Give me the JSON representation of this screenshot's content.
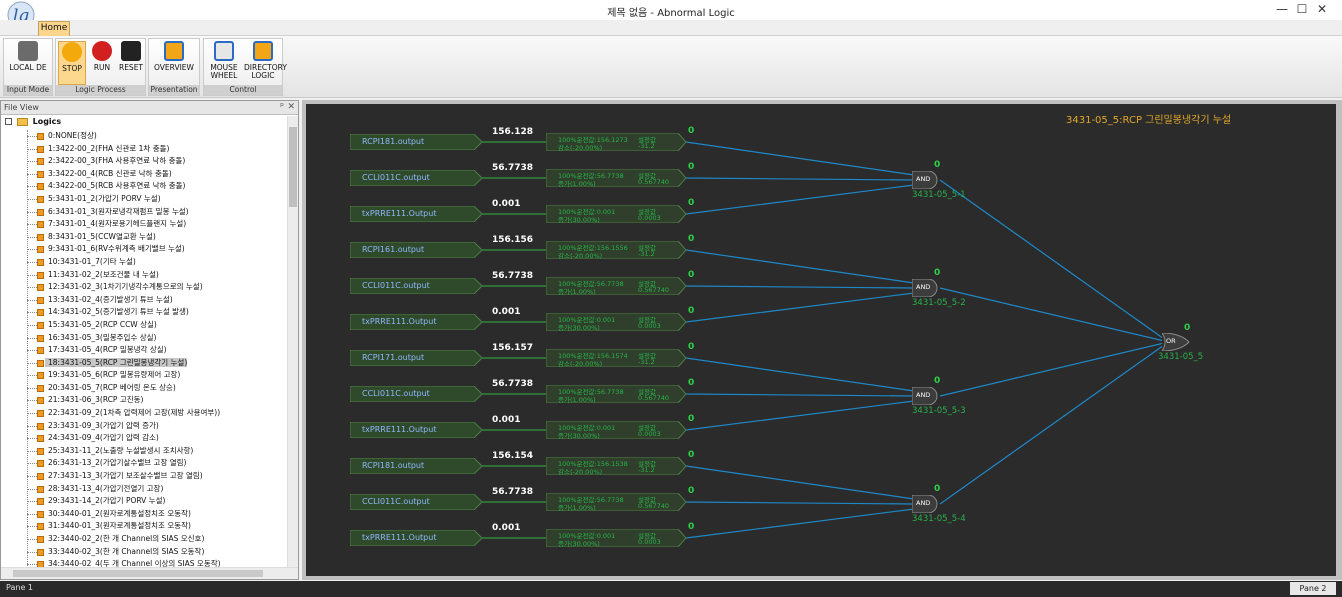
{
  "window": {
    "title": "제목 없음 - Abnormal Logic",
    "minimize": "—",
    "maximize": "☐",
    "close": "✕"
  },
  "ribbon": {
    "tab_home": "Home",
    "groups": {
      "input_mode": "Input Mode",
      "logic_process": "Logic Process",
      "presentation": "Presentation",
      "control": "Control"
    },
    "buttons": {
      "local_de": "LOCAL DE",
      "stop": "STOP",
      "run": "RUN",
      "reset": "RESET",
      "overview": "OVERVIEW",
      "mouse_wheel": "MOUSE WHEEL",
      "directory_logic": "DIRECTORY LOGIC"
    }
  },
  "file_view": {
    "title": "File View",
    "pin": "ᵖ",
    "close": "✕",
    "root": "Logics",
    "items": [
      "0:NONE(정상)",
      "1:3422-00_2(FHA 신관로 1차 충돌)",
      "2:3422-00_3(FHA 사용후연료 낙하 충돌)",
      "3:3422-00_4(RCB 신관로 낙하 충돌)",
      "4:3422-00_5(RCB 사용후연료 낙하 충돌)",
      "5:3431-01_2(가압기 PORV 누설)",
      "6:3431-01_3(원자로냉각재펌프 밀봉 누설)",
      "7:3431-01_4(원자로용기헤드플랜지 누설)",
      "8:3431-01_5(CCW열교환 누설)",
      "9:3431-01_6(RV수위계측 배기밸브 누설)",
      "10:3431-01_7(기타 누설)",
      "11:3431-02_2(보조건물 내 누설)",
      "12:3431-02_3(1차기기냉각수계통으로의 누설)",
      "13:3431-02_4(증기발생기 튜브 누설)",
      "14:3431-02_5(증기발생기 튜브 누설 발생)",
      "15:3431-05_2(RCP CCW 상실)",
      "16:3431-05_3(밀봉주입수 상실)",
      "17:3431-05_4(RCP 밀봉냉각 상실)",
      "18:3431-05_5(RCP 그린밀봉냉각기 누설)",
      "19:3431-05_6(RCP 밀봉유량제어 고장)",
      "20:3431-05_7(RCP 베어링 온도 상승)",
      "21:3431-06_3(RCP 고진동)",
      "22:3431-09_2(1차측 압력제어 고장(제방 사용여부))",
      "23:3431-09_3(가압기 압력 증가)",
      "24:3431-09_4(가압기 압력 감소)",
      "25:3431-11_2(노출량 누설발생시 조치사항)",
      "26:3431-13_2(가압기살수밸브 고장 열림)",
      "27:3431-13_3(가압기 보조살수밸브 고장 열림)",
      "28:3431-13_4(가압기전열기 고장)",
      "29:3431-14_2(가압기 PORV 누설)",
      "30:3440-01_2(원자로계통설정치조 오동작)",
      "31:3440-01_3(원자로계통설정치조 오동작)",
      "32:3440-02_2(한 개 Channel의 SIAS 오신호)",
      "33:3440-02_3(한 개 Channel의 SIAS 오동작)",
      "34:3440-02_4(두 개 Channel 이상의 SIAS 오동작)"
    ]
  },
  "diagram": {
    "title": "3431-05_5:RCP 그린밀봉냉각기 누설",
    "groups": [
      {
        "inputs": [
          "RCPI181.output",
          "CCLI011C.output",
          "txPRRE111.Output"
        ],
        "values": [
          "156.128",
          "56.7738",
          "0.001"
        ],
        "tests": [
          {
            "l1": "100%운전값:156.1273",
            "l2": "감소(-20.00%)",
            "r1": "설정값",
            "r2": "-31.2"
          },
          {
            "l1": "100%운전값:56.7738",
            "l2": "증가(1.00%)",
            "r1": "설정값",
            "r2": "0.567740"
          },
          {
            "l1": "100%운전값:0.001",
            "l2": "증가(30.00%)",
            "r1": "설정값",
            "r2": "0.0003"
          }
        ],
        "bits": [
          "0",
          "0",
          "0"
        ],
        "gate": "AND",
        "gate_out": "0",
        "gate_name": "3431-05_5-1"
      },
      {
        "inputs": [
          "RCPI161.output",
          "CCLI011C.output",
          "txPRRE111.Output"
        ],
        "values": [
          "156.156",
          "56.7738",
          "0.001"
        ],
        "tests": [
          {
            "l1": "100%운전값:156.1556",
            "l2": "감소(-20.00%)",
            "r1": "설정값",
            "r2": "-31.2"
          },
          {
            "l1": "100%운전값:56.7738",
            "l2": "증가(1.00%)",
            "r1": "설정값",
            "r2": "0.567740"
          },
          {
            "l1": "100%운전값:0.001",
            "l2": "증가(30.00%)",
            "r1": "설정값",
            "r2": "0.0003"
          }
        ],
        "bits": [
          "0",
          "0",
          "0"
        ],
        "gate": "AND",
        "gate_out": "0",
        "gate_name": "3431-05_5-2"
      },
      {
        "inputs": [
          "RCPI171.output",
          "CCLI011C.output",
          "txPRRE111.Output"
        ],
        "values": [
          "156.157",
          "56.7738",
          "0.001"
        ],
        "tests": [
          {
            "l1": "100%운전값:156.1574",
            "l2": "감소(-20.00%)",
            "r1": "설정값",
            "r2": "-31.2"
          },
          {
            "l1": "100%운전값:56.7738",
            "l2": "증가(1.00%)",
            "r1": "설정값",
            "r2": "0.567740"
          },
          {
            "l1": "100%운전값:0.001",
            "l2": "증가(30.00%)",
            "r1": "설정값",
            "r2": "0.0003"
          }
        ],
        "bits": [
          "0",
          "0",
          "0"
        ],
        "gate": "AND",
        "gate_out": "0",
        "gate_name": "3431-05_5-3"
      },
      {
        "inputs": [
          "RCPI181.output",
          "CCLI011C.output",
          "txPRRE111.Output"
        ],
        "values": [
          "156.154",
          "56.7738",
          "0.001"
        ],
        "tests": [
          {
            "l1": "100%운전값:156.1538",
            "l2": "감소(-20.00%)",
            "r1": "설정값",
            "r2": "-31.2"
          },
          {
            "l1": "100%운전값:56.7738",
            "l2": "증가(1.00%)",
            "r1": "설정값",
            "r2": "0.567740"
          },
          {
            "l1": "100%운전값:0.001",
            "l2": "증가(30.00%)",
            "r1": "설정값",
            "r2": "0.0003"
          }
        ],
        "bits": [
          "0",
          "0",
          "0"
        ],
        "gate": "AND",
        "gate_out": "0",
        "gate_name": "3431-05_5-4"
      }
    ],
    "or_gate": {
      "label": "OR",
      "out": "0",
      "name": "3431-05_5"
    }
  },
  "status": {
    "left": "Pane 1",
    "right": "Pane 2"
  }
}
